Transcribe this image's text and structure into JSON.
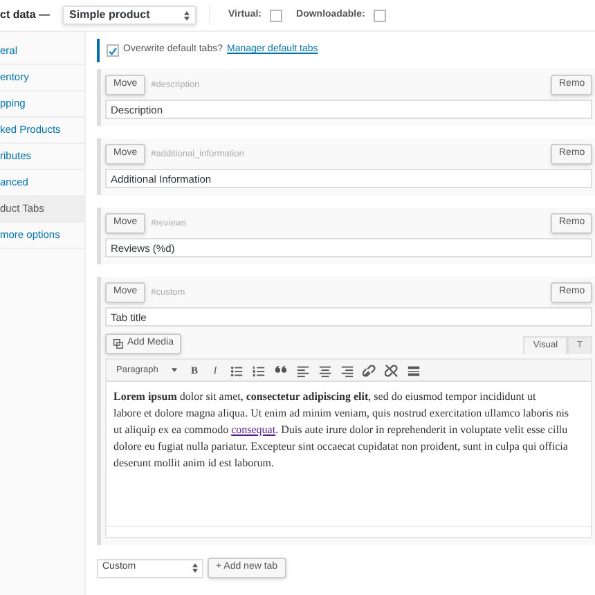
{
  "header": {
    "title": "ct data —",
    "product_type": "Simple product",
    "options": [
      {
        "label": "Virtual:",
        "checked": false
      },
      {
        "label": "Downloadable:",
        "checked": false
      }
    ]
  },
  "sidebar": {
    "items": [
      {
        "label": "eral",
        "selected": false
      },
      {
        "label": "entory",
        "selected": false
      },
      {
        "label": "pping",
        "selected": false
      },
      {
        "label": "ked Products",
        "selected": false
      },
      {
        "label": "ributes",
        "selected": false
      },
      {
        "label": "anced",
        "selected": false
      },
      {
        "label": "duct Tabs",
        "selected": true
      },
      {
        "label": "more options",
        "selected": false
      }
    ]
  },
  "overwrite": {
    "checked": true,
    "label": "Overwrite default tabs?",
    "link": "Manager default tabs"
  },
  "tabs": [
    {
      "kind": "simple",
      "move": "Move",
      "key": "#description",
      "remove": "Remo",
      "title": "Description"
    },
    {
      "kind": "simple",
      "move": "Move",
      "key": "#additional_information",
      "remove": "Remo",
      "title": "Additional Information"
    },
    {
      "kind": "simple",
      "move": "Move",
      "key": "#reviews",
      "remove": "Remo",
      "title": "Reviews (%d)"
    },
    {
      "kind": "editor",
      "move": "Move",
      "key": "#custom",
      "remove": "Remo",
      "title": "Tab title",
      "editor": {
        "add_media": "Add Media",
        "modes": [
          {
            "label": "Visual",
            "selected": true
          },
          {
            "label": "T",
            "selected": false
          }
        ],
        "format": "Paragraph",
        "tools": [
          {
            "kind": "bold",
            "label": "B"
          },
          {
            "kind": "italic",
            "label": "I"
          },
          {
            "kind": "bullets"
          },
          {
            "kind": "numbers"
          },
          {
            "kind": "quote"
          },
          {
            "kind": "align-left"
          },
          {
            "kind": "align-center"
          },
          {
            "kind": "align-right"
          },
          {
            "kind": "link"
          },
          {
            "kind": "unlink"
          },
          {
            "kind": "more"
          }
        ],
        "lines": [
          {
            "text": "**Lorem ipsum** dolor sit amet, **consectetur adipiscing elit**, sed do eiusmod tempor incididunt ut"
          },
          {
            "text": "labore et dolore magna aliqua. Ut enim ad minim veniam, quis nostrud exercitation ullamco laboris nis"
          },
          {
            "text": "ut aliquip ex ea commodo ",
            "link": "consequat",
            "after": ". Duis aute irure dolor in reprehenderit in voluptate velit esse cillu"
          },
          {
            "text": "dolore eu fugiat nulla pariatur. Excepteur sint occaecat cupidatat non proident, sunt in culpa qui officia"
          },
          {
            "text": "deserunt mollit anim id est laborum."
          }
        ]
      }
    }
  ],
  "footer": {
    "select": "Custom",
    "add": "+ Add new tab"
  }
}
